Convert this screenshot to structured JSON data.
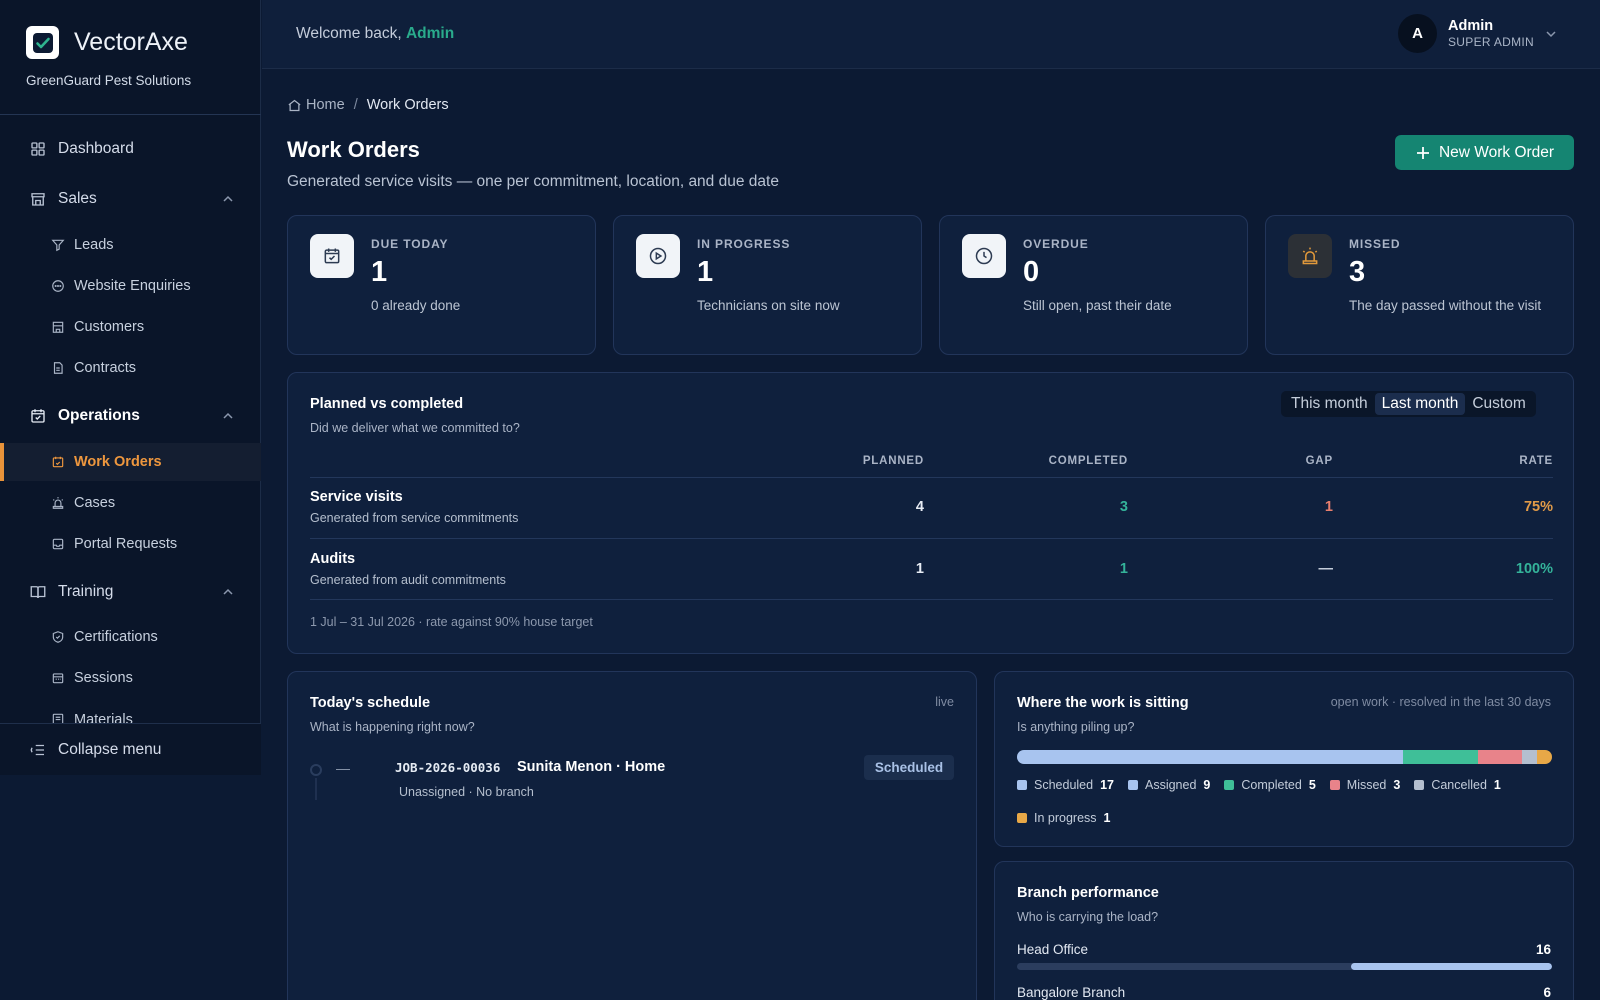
{
  "sidebar": {
    "brand": "VectorAxe",
    "company": "GreenGuard Pest Solutions",
    "dashboard": "Dashboard",
    "sales": {
      "label": "Sales",
      "items": [
        "Leads",
        "Website Enquiries",
        "Customers",
        "Contracts"
      ]
    },
    "operations": {
      "label": "Operations",
      "items": [
        "Work Orders",
        "Cases",
        "Portal Requests"
      ]
    },
    "training": {
      "label": "Training",
      "items": [
        "Certifications",
        "Sessions",
        "Materials"
      ]
    },
    "collapse": "Collapse menu",
    "active_item": "Work Orders",
    "accent": "#e8933a"
  },
  "topbar": {
    "welcome_prefix": "Welcome back,",
    "welcome_name": "Admin",
    "avatar_initial": "A",
    "user_name": "Admin",
    "user_role": "SUPER ADMIN"
  },
  "breadcrumb": {
    "home": "Home",
    "sep": "/",
    "current": "Work Orders"
  },
  "page": {
    "title": "Work Orders",
    "subtitle": "Generated service visits — one per commitment, location, and due date",
    "new_button": "New Work Order"
  },
  "stats": [
    {
      "label": "DUE TODAY",
      "value": "1",
      "desc": "0 already done",
      "icon": "calendar-check-icon"
    },
    {
      "label": "IN PROGRESS",
      "value": "1",
      "desc": "Technicians on site now",
      "icon": "play-circle-icon"
    },
    {
      "label": "OVERDUE",
      "value": "0",
      "desc": "Still open, past their date",
      "icon": "clock-icon"
    },
    {
      "label": "MISSED",
      "value": "3",
      "desc": "The day passed without the visit",
      "icon": "siren-icon"
    }
  ],
  "planned": {
    "title": "Planned vs completed",
    "subtitle": "Did we deliver what we committed to?",
    "ranges": [
      "This month",
      "Last month",
      "Custom"
    ],
    "selected_range": "Last month",
    "columns": [
      "PLANNED",
      "COMPLETED",
      "GAP",
      "RATE"
    ],
    "rows": [
      {
        "title": "Service visits",
        "sub": "Generated from service commitments",
        "planned": "4",
        "completed": "3",
        "gap": "1",
        "rate": "75%"
      },
      {
        "title": "Audits",
        "sub": "Generated from audit commitments",
        "planned": "1",
        "completed": "1",
        "gap": "—",
        "rate": "100%"
      }
    ],
    "footer": "1 Jul – 31 Jul 2026 · rate against 90% house target"
  },
  "schedule": {
    "title": "Today's schedule",
    "subtitle": "What is happening right now?",
    "live": "live",
    "items": [
      {
        "time": "—",
        "job_id": "JOB-2026-00036",
        "who": "Sunita Menon · Home",
        "meta": "Unassigned · No branch",
        "status": "Scheduled"
      }
    ]
  },
  "where": {
    "title": "Where the work is sitting",
    "subtitle": "Is anything piling up?",
    "note": "open work · resolved in the last 30 days",
    "segments": [
      {
        "label": "Scheduled",
        "count": 17,
        "color": "#a8c4ef"
      },
      {
        "label": "Assigned",
        "count": 9,
        "color": "#a8c4ef"
      },
      {
        "label": "Completed",
        "count": 5,
        "color": "#3fbf98"
      },
      {
        "label": "Missed",
        "count": 3,
        "color": "#e8838a"
      },
      {
        "label": "Cancelled",
        "count": 1,
        "color": "#b4bfcf"
      },
      {
        "label": "In progress",
        "count": 1,
        "color": "#e8a847"
      }
    ]
  },
  "branch": {
    "title": "Branch performance",
    "subtitle": "Who is carrying the load?",
    "rows": [
      {
        "name": "Head Office",
        "value": "16",
        "fraction": 0.375
      },
      {
        "name": "Bangalore Branch",
        "value": "6",
        "fraction": 0.1
      }
    ]
  }
}
